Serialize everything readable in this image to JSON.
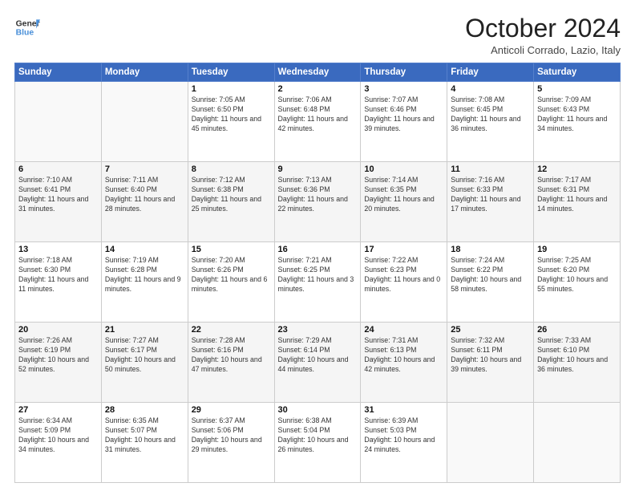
{
  "header": {
    "logo_line1": "General",
    "logo_line2": "Blue",
    "month_title": "October 2024",
    "location": "Anticoli Corrado, Lazio, Italy"
  },
  "days_of_week": [
    "Sunday",
    "Monday",
    "Tuesday",
    "Wednesday",
    "Thursday",
    "Friday",
    "Saturday"
  ],
  "weeks": [
    [
      {
        "day": "",
        "text": ""
      },
      {
        "day": "",
        "text": ""
      },
      {
        "day": "1",
        "text": "Sunrise: 7:05 AM\nSunset: 6:50 PM\nDaylight: 11 hours and 45 minutes."
      },
      {
        "day": "2",
        "text": "Sunrise: 7:06 AM\nSunset: 6:48 PM\nDaylight: 11 hours and 42 minutes."
      },
      {
        "day": "3",
        "text": "Sunrise: 7:07 AM\nSunset: 6:46 PM\nDaylight: 11 hours and 39 minutes."
      },
      {
        "day": "4",
        "text": "Sunrise: 7:08 AM\nSunset: 6:45 PM\nDaylight: 11 hours and 36 minutes."
      },
      {
        "day": "5",
        "text": "Sunrise: 7:09 AM\nSunset: 6:43 PM\nDaylight: 11 hours and 34 minutes."
      }
    ],
    [
      {
        "day": "6",
        "text": "Sunrise: 7:10 AM\nSunset: 6:41 PM\nDaylight: 11 hours and 31 minutes."
      },
      {
        "day": "7",
        "text": "Sunrise: 7:11 AM\nSunset: 6:40 PM\nDaylight: 11 hours and 28 minutes."
      },
      {
        "day": "8",
        "text": "Sunrise: 7:12 AM\nSunset: 6:38 PM\nDaylight: 11 hours and 25 minutes."
      },
      {
        "day": "9",
        "text": "Sunrise: 7:13 AM\nSunset: 6:36 PM\nDaylight: 11 hours and 22 minutes."
      },
      {
        "day": "10",
        "text": "Sunrise: 7:14 AM\nSunset: 6:35 PM\nDaylight: 11 hours and 20 minutes."
      },
      {
        "day": "11",
        "text": "Sunrise: 7:16 AM\nSunset: 6:33 PM\nDaylight: 11 hours and 17 minutes."
      },
      {
        "day": "12",
        "text": "Sunrise: 7:17 AM\nSunset: 6:31 PM\nDaylight: 11 hours and 14 minutes."
      }
    ],
    [
      {
        "day": "13",
        "text": "Sunrise: 7:18 AM\nSunset: 6:30 PM\nDaylight: 11 hours and 11 minutes."
      },
      {
        "day": "14",
        "text": "Sunrise: 7:19 AM\nSunset: 6:28 PM\nDaylight: 11 hours and 9 minutes."
      },
      {
        "day": "15",
        "text": "Sunrise: 7:20 AM\nSunset: 6:26 PM\nDaylight: 11 hours and 6 minutes."
      },
      {
        "day": "16",
        "text": "Sunrise: 7:21 AM\nSunset: 6:25 PM\nDaylight: 11 hours and 3 minutes."
      },
      {
        "day": "17",
        "text": "Sunrise: 7:22 AM\nSunset: 6:23 PM\nDaylight: 11 hours and 0 minutes."
      },
      {
        "day": "18",
        "text": "Sunrise: 7:24 AM\nSunset: 6:22 PM\nDaylight: 10 hours and 58 minutes."
      },
      {
        "day": "19",
        "text": "Sunrise: 7:25 AM\nSunset: 6:20 PM\nDaylight: 10 hours and 55 minutes."
      }
    ],
    [
      {
        "day": "20",
        "text": "Sunrise: 7:26 AM\nSunset: 6:19 PM\nDaylight: 10 hours and 52 minutes."
      },
      {
        "day": "21",
        "text": "Sunrise: 7:27 AM\nSunset: 6:17 PM\nDaylight: 10 hours and 50 minutes."
      },
      {
        "day": "22",
        "text": "Sunrise: 7:28 AM\nSunset: 6:16 PM\nDaylight: 10 hours and 47 minutes."
      },
      {
        "day": "23",
        "text": "Sunrise: 7:29 AM\nSunset: 6:14 PM\nDaylight: 10 hours and 44 minutes."
      },
      {
        "day": "24",
        "text": "Sunrise: 7:31 AM\nSunset: 6:13 PM\nDaylight: 10 hours and 42 minutes."
      },
      {
        "day": "25",
        "text": "Sunrise: 7:32 AM\nSunset: 6:11 PM\nDaylight: 10 hours and 39 minutes."
      },
      {
        "day": "26",
        "text": "Sunrise: 7:33 AM\nSunset: 6:10 PM\nDaylight: 10 hours and 36 minutes."
      }
    ],
    [
      {
        "day": "27",
        "text": "Sunrise: 6:34 AM\nSunset: 5:09 PM\nDaylight: 10 hours and 34 minutes."
      },
      {
        "day": "28",
        "text": "Sunrise: 6:35 AM\nSunset: 5:07 PM\nDaylight: 10 hours and 31 minutes."
      },
      {
        "day": "29",
        "text": "Sunrise: 6:37 AM\nSunset: 5:06 PM\nDaylight: 10 hours and 29 minutes."
      },
      {
        "day": "30",
        "text": "Sunrise: 6:38 AM\nSunset: 5:04 PM\nDaylight: 10 hours and 26 minutes."
      },
      {
        "day": "31",
        "text": "Sunrise: 6:39 AM\nSunset: 5:03 PM\nDaylight: 10 hours and 24 minutes."
      },
      {
        "day": "",
        "text": ""
      },
      {
        "day": "",
        "text": ""
      }
    ]
  ]
}
